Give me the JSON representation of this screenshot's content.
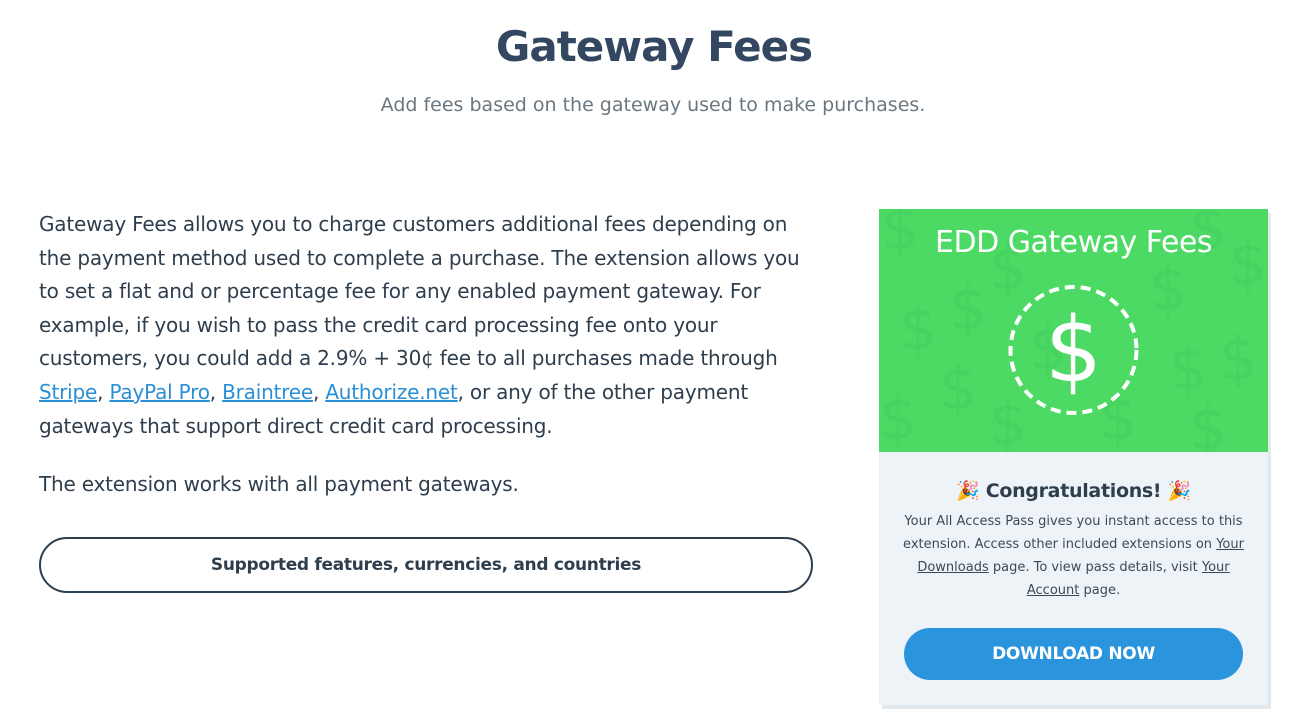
{
  "header": {
    "title": "Gateway Fees",
    "subtitle": "Add fees based on the gateway used to make purchases."
  },
  "description": {
    "text_1": "Gateway Fees allows you to charge customers additional fees depending on the payment method used to complete a purchase. The extension allows you to set a flat and or percentage fee for any enabled payment gateway. For example, if you wish to pass the credit card processing fee onto your customers, you could add a 2.9% + 30¢ fee to all purchases made through ",
    "link_stripe": "Stripe",
    "sep_1": ", ",
    "link_paypal": "PayPal Pro",
    "sep_2": ", ",
    "link_braintree": "Braintree",
    "sep_3": ", ",
    "link_authorize": "Authorize.net",
    "text_2": ", or any of the other payment gateways that support direct credit card processing.",
    "works_with": "The extension works with all payment gateways."
  },
  "features_button_label": "Supported features, currencies, and countries",
  "card": {
    "banner_title": "EDD Gateway Fees",
    "banner_icon": "dollar-coin-icon",
    "congrats_emoji": "🎉",
    "congrats_title": "Congratulations!",
    "text_1": "Your All Access Pass gives you instant access to this extension. Access other included extensions on ",
    "link_downloads": "Your Downloads",
    "text_2": " page. To view pass details, visit ",
    "link_account": "Your Account",
    "text_3": " page.",
    "download_label": "DOWNLOAD NOW"
  },
  "colors": {
    "banner_green": "#4cd964",
    "link_blue": "#2b8fd6",
    "button_blue": "#2a94dc",
    "heading": "#334860"
  }
}
